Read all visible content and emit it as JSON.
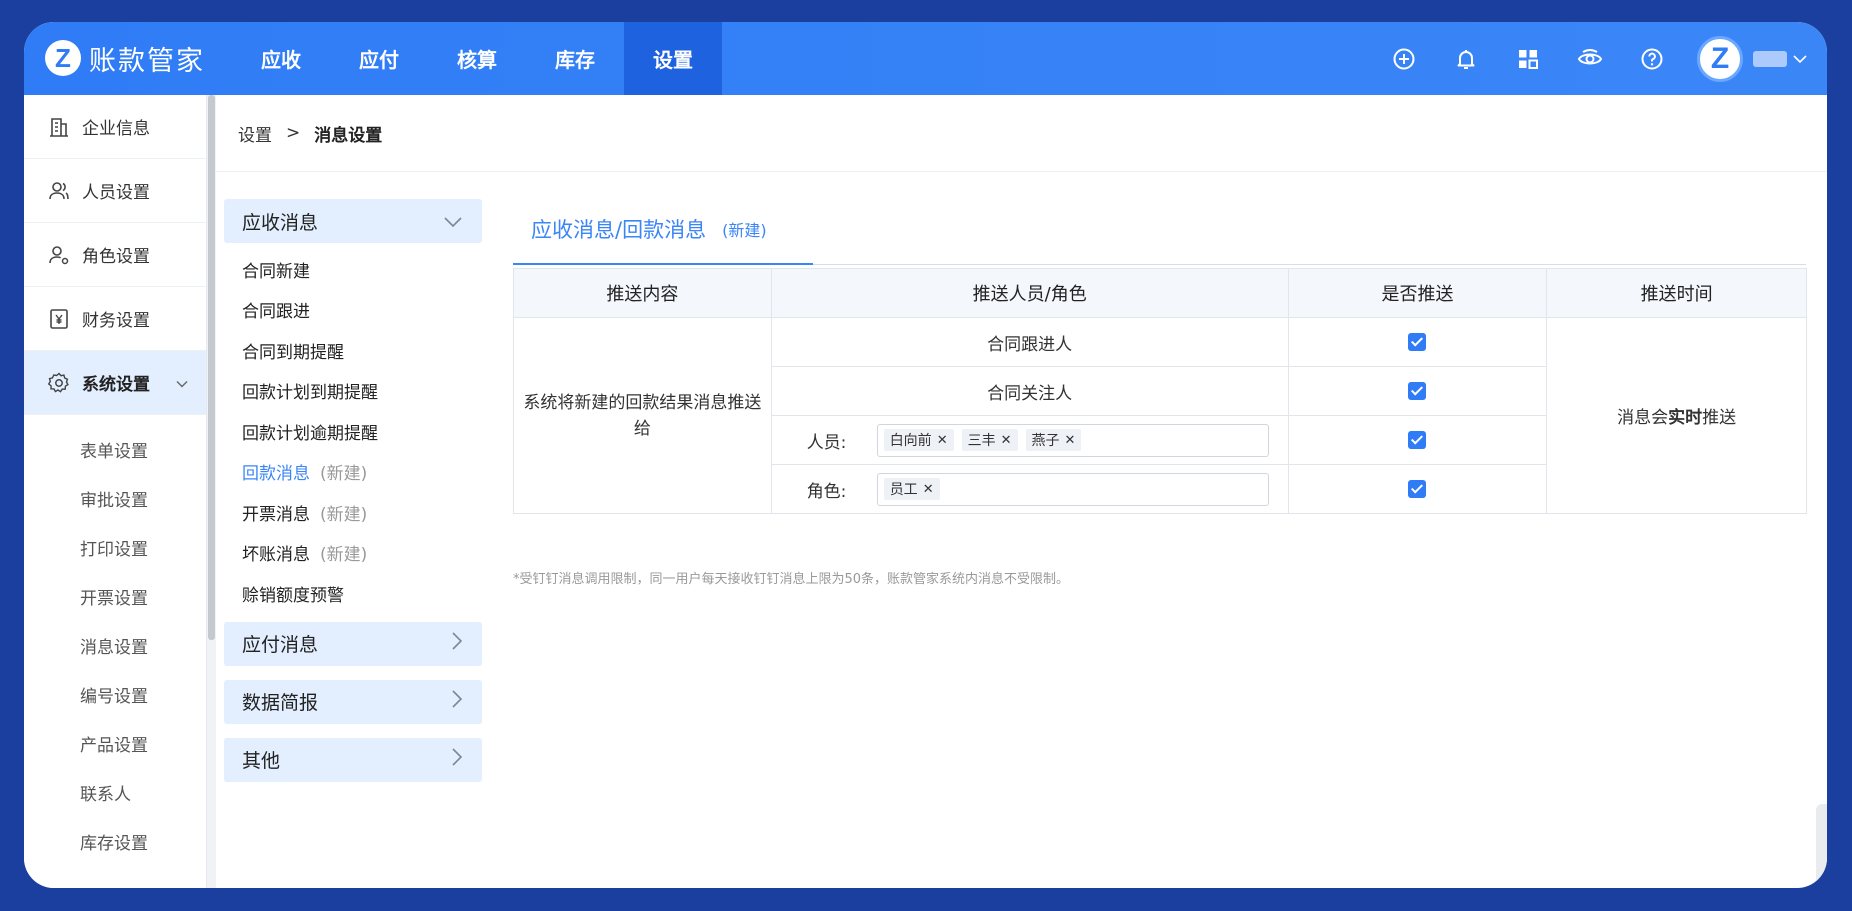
{
  "app": {
    "logo_glyph": "Z",
    "name": "账款管家"
  },
  "nav": [
    {
      "label": "应收",
      "active": false
    },
    {
      "label": "应付",
      "active": false
    },
    {
      "label": "核算",
      "active": false
    },
    {
      "label": "库存",
      "active": false
    },
    {
      "label": "设置",
      "active": true
    }
  ],
  "top_icons": [
    "plus-circle-icon",
    "bell-icon",
    "grid-icon",
    "eye-support-icon",
    "help-icon"
  ],
  "user": {
    "avatar_glyph": "Z"
  },
  "sidebar": {
    "main_items": [
      {
        "label": "企业信息",
        "icon": "building-icon"
      },
      {
        "label": "人员设置",
        "icon": "users-icon"
      },
      {
        "label": "角色设置",
        "icon": "user-gear-icon"
      },
      {
        "label": "财务设置",
        "icon": "yen-doc-icon"
      },
      {
        "label": "系统设置",
        "icon": "gear-icon",
        "active": true
      }
    ],
    "sub_items": [
      "表单设置",
      "审批设置",
      "打印设置",
      "开票设置",
      "消息设置",
      "编号设置",
      "产品设置",
      "联系人",
      "库存设置"
    ]
  },
  "breadcrumb": {
    "root": "设置",
    "separator": ">",
    "current": "消息设置"
  },
  "message_menu": {
    "groups": [
      {
        "label": "应收消息",
        "expanded": true,
        "items": [
          {
            "label": "合同新建",
            "new": ""
          },
          {
            "label": "合同跟进",
            "new": ""
          },
          {
            "label": "合同到期提醒",
            "new": ""
          },
          {
            "label": "回款计划到期提醒",
            "new": ""
          },
          {
            "label": "回款计划逾期提醒",
            "new": ""
          },
          {
            "label": "回款消息",
            "new": "(新建)",
            "active": true
          },
          {
            "label": "开票消息",
            "new": "(新建)"
          },
          {
            "label": "坏账消息",
            "new": "(新建)"
          },
          {
            "label": "赊销额度预警",
            "new": ""
          }
        ]
      },
      {
        "label": "应付消息",
        "expanded": false
      },
      {
        "label": "数据简报",
        "expanded": false
      },
      {
        "label": "其他",
        "expanded": false
      }
    ]
  },
  "tab": {
    "title": "应收消息/回款消息",
    "suffix": "(新建)"
  },
  "table": {
    "headers": [
      "推送内容",
      "推送人员/角色",
      "是否推送",
      "推送时间"
    ],
    "content": "系统将新建的回款结果消息推送给",
    "rows": [
      {
        "recipient": "合同跟进人",
        "push": true
      },
      {
        "recipient": "合同关注人",
        "push": true
      },
      {
        "label": "人员:",
        "tags": [
          "白向前",
          "三丰",
          "燕子"
        ],
        "push": true
      },
      {
        "label": "角色:",
        "tags": [
          "员工"
        ],
        "push": true
      }
    ],
    "time": {
      "prefix": "消息会",
      "emphasis": "实时",
      "suffix": "推送"
    }
  },
  "note": "*受钉钉消息调用限制，同一用户每天接收钉钉消息上限为50条，账款管家系统内消息不受限制。",
  "colors": {
    "primary": "#2f7cf6",
    "active_nav": "#1e62e0",
    "menu_bg": "#e3eefe",
    "frame": "#1b3f9e"
  }
}
